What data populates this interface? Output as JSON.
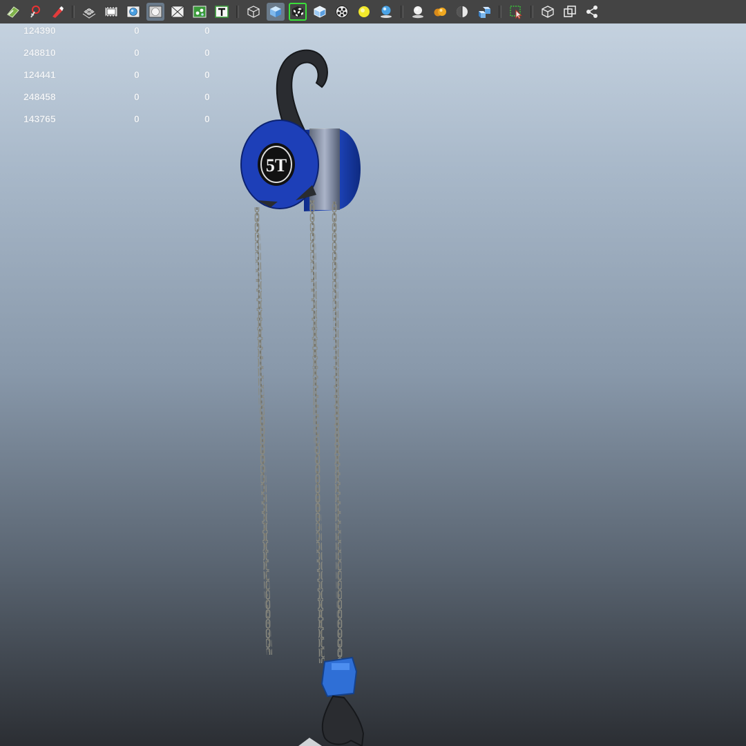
{
  "toolbar": {
    "groups": [
      [
        {
          "icon": "select-camera-icon"
        },
        {
          "icon": "lock-camera-icon"
        },
        {
          "icon": "bookmark-icon"
        }
      ],
      [
        {
          "icon": "grid-icon"
        },
        {
          "icon": "film-gate-icon"
        },
        {
          "icon": "resolution-gate-icon"
        },
        {
          "icon": "gate-mask-icon",
          "active": true
        },
        {
          "icon": "field-chart-icon"
        },
        {
          "icon": "safe-action-icon"
        },
        {
          "icon": "safe-title-icon"
        }
      ],
      [
        {
          "icon": "wireframe-icon"
        },
        {
          "icon": "smooth-shade-icon",
          "active": true
        },
        {
          "icon": "textured-icon",
          "selected": true
        },
        {
          "icon": "wireframe-on-shaded-icon"
        },
        {
          "icon": "xray-icon"
        },
        {
          "icon": "default-light-icon"
        },
        {
          "icon": "all-lights-icon"
        }
      ],
      [
        {
          "icon": "shadows-icon"
        },
        {
          "icon": "screen-space-ao-icon"
        },
        {
          "icon": "motion-blur-icon"
        },
        {
          "icon": "multisample-aa-icon"
        }
      ],
      [
        {
          "icon": "isolate-select-icon"
        }
      ],
      [
        {
          "icon": "xray-joints-icon"
        },
        {
          "icon": "xray-active-icon"
        },
        {
          "icon": "share-icon"
        }
      ]
    ]
  },
  "hud": {
    "rows": [
      [
        "124390",
        "0",
        "0"
      ],
      [
        "248810",
        "0",
        "0"
      ],
      [
        "124441",
        "0",
        "0"
      ],
      [
        "248458",
        "0",
        "0"
      ],
      [
        "143765",
        "0",
        "0"
      ]
    ]
  },
  "viewport": {
    "object": "chain-hoist",
    "label": "5T",
    "colors": {
      "body": "#1d3fb8",
      "hook": "#2a2c30",
      "chain": "#8a8a80",
      "block": "#2f6fd6"
    }
  }
}
